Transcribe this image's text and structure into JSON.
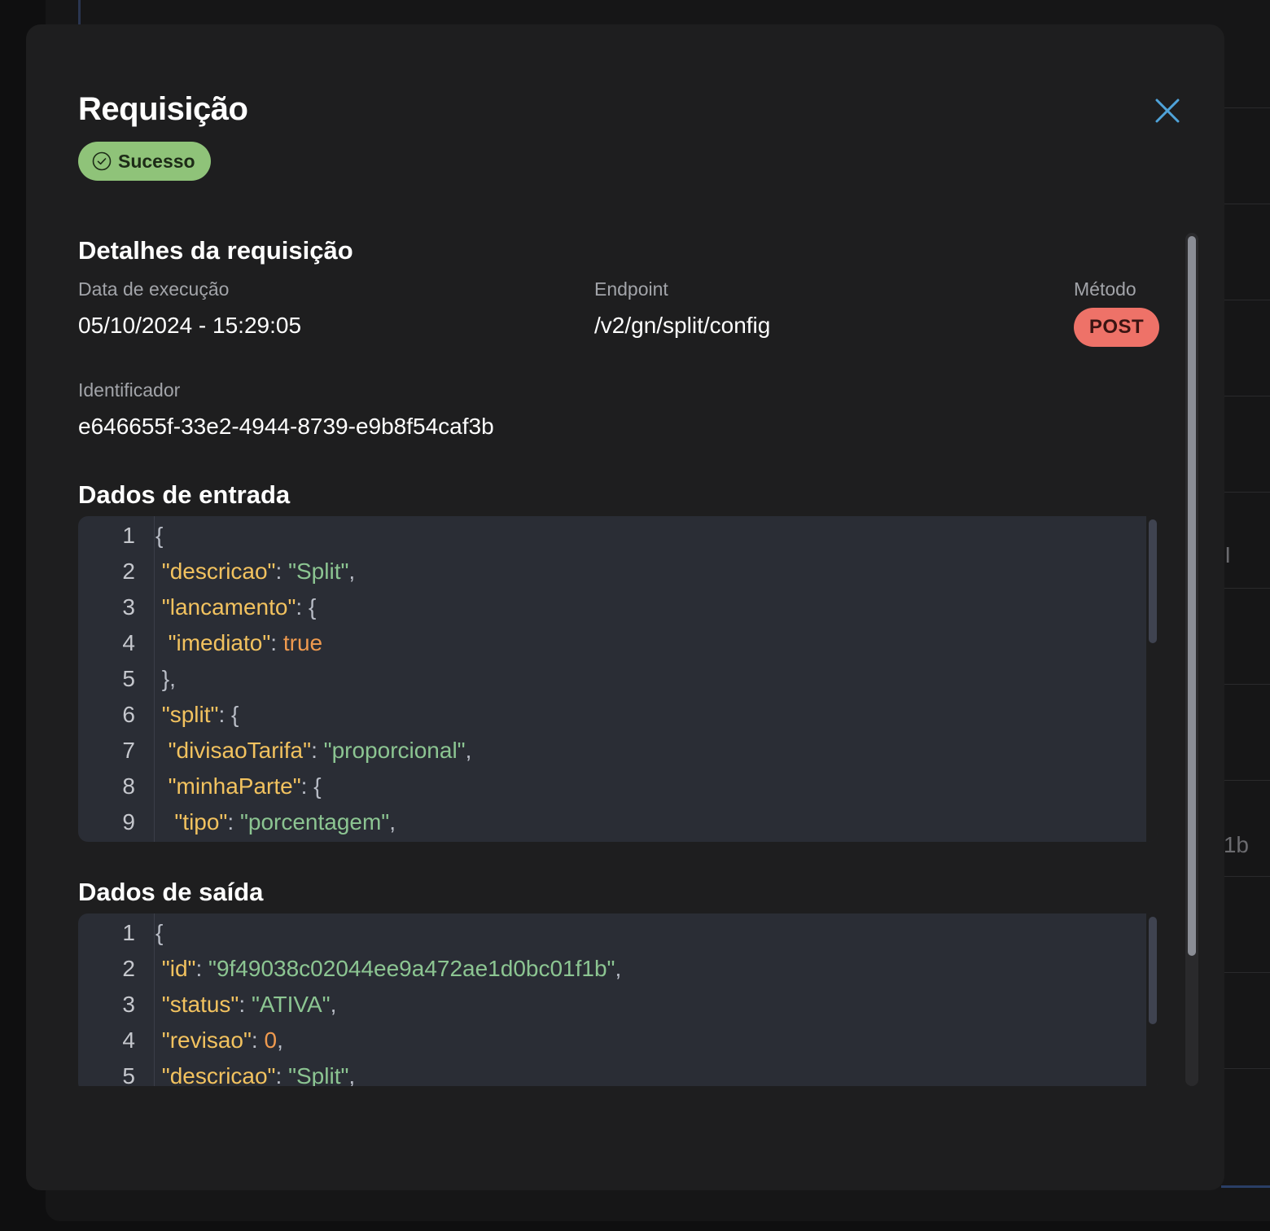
{
  "modal": {
    "title": "Requisição",
    "status": "Sucesso",
    "close_icon": "close-icon"
  },
  "details": {
    "section_title": "Detalhes da requisição",
    "execution_date_label": "Data de execução",
    "execution_date": "05/10/2024 - 15:29:05",
    "endpoint_label": "Endpoint",
    "endpoint": "/v2/gn/split/config",
    "method_label": "Método",
    "method": "POST",
    "identifier_label": "Identificador",
    "identifier": "e646655f-33e2-4944-8739-e9b8f54caf3b"
  },
  "input_data": {
    "section_title": "Dados de entrada",
    "lines": [
      {
        "n": "1",
        "indent": "",
        "key": "",
        "sep": "",
        "val": "",
        "vtype": "",
        "tail": "{"
      },
      {
        "n": "2",
        "indent": " ",
        "key": "\"descricao\"",
        "sep": ": ",
        "val": "\"Split\"",
        "vtype": "s",
        "tail": ","
      },
      {
        "n": "3",
        "indent": " ",
        "key": "\"lancamento\"",
        "sep": ": ",
        "val": "",
        "vtype": "",
        "tail": "{"
      },
      {
        "n": "4",
        "indent": "  ",
        "key": "\"imediato\"",
        "sep": ": ",
        "val": "true",
        "vtype": "b",
        "tail": ""
      },
      {
        "n": "5",
        "indent": " ",
        "key": "",
        "sep": "",
        "val": "",
        "vtype": "",
        "tail": "},"
      },
      {
        "n": "6",
        "indent": " ",
        "key": "\"split\"",
        "sep": ": ",
        "val": "",
        "vtype": "",
        "tail": "{"
      },
      {
        "n": "7",
        "indent": "  ",
        "key": "\"divisaoTarifa\"",
        "sep": ": ",
        "val": "\"proporcional\"",
        "vtype": "s",
        "tail": ","
      },
      {
        "n": "8",
        "indent": "  ",
        "key": "\"minhaParte\"",
        "sep": ": ",
        "val": "",
        "vtype": "",
        "tail": "{"
      },
      {
        "n": "9",
        "indent": "   ",
        "key": "\"tipo\"",
        "sep": ": ",
        "val": "\"porcentagem\"",
        "vtype": "s",
        "tail": ","
      }
    ]
  },
  "output_data": {
    "section_title": "Dados de saída",
    "lines": [
      {
        "n": "1",
        "indent": "",
        "key": "",
        "sep": "",
        "val": "",
        "vtype": "",
        "tail": "{"
      },
      {
        "n": "2",
        "indent": " ",
        "key": "\"id\"",
        "sep": ": ",
        "val": "\"9f49038c02044ee9a472ae1d0bc01f1b\"",
        "vtype": "s",
        "tail": ","
      },
      {
        "n": "3",
        "indent": " ",
        "key": "\"status\"",
        "sep": ": ",
        "val": "\"ATIVA\"",
        "vtype": "s",
        "tail": ","
      },
      {
        "n": "4",
        "indent": " ",
        "key": "\"revisao\"",
        "sep": ": ",
        "val": "0",
        "vtype": "n",
        "tail": ","
      },
      {
        "n": "5",
        "indent": " ",
        "key": "\"descricao\"",
        "sep": ": ",
        "val": "\"Split\"",
        "vtype": "s",
        "tail": ","
      }
    ]
  },
  "background_fragments": [
    "I",
    "1b"
  ],
  "colors": {
    "success": "#8fc379",
    "method_post": "#ee7268",
    "json_key": "#f2c25f",
    "json_string": "#8cc592",
    "json_literal": "#ef9a4f",
    "close_icon": "#4fa3d9"
  }
}
